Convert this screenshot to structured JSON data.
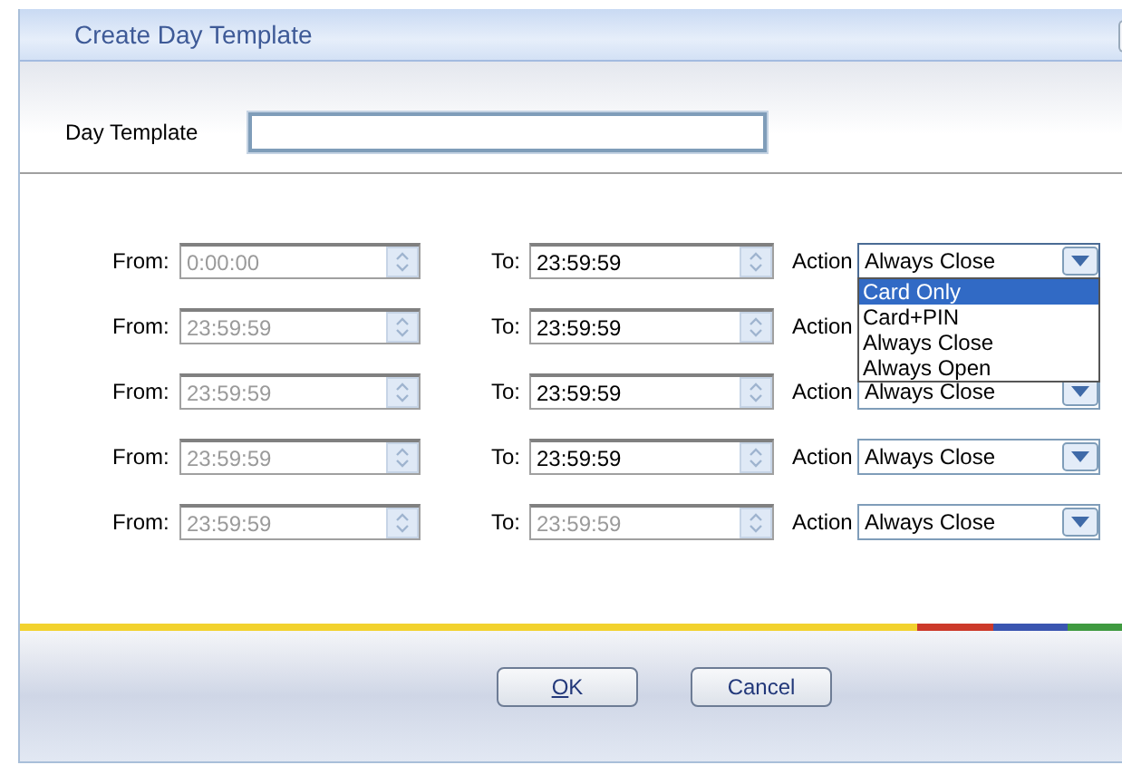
{
  "window": {
    "title": "Create Day Template"
  },
  "day_template": {
    "label": "Day Template"
  },
  "rows": [
    {
      "from_label": "From:",
      "from": "0:00:00",
      "from_disabled": true,
      "to_label": "To:",
      "to": "23:59:59",
      "to_disabled": false,
      "action_label": "Action",
      "action": "Always Close",
      "expanded": true,
      "options": [
        {
          "label": "Card Only",
          "selected": true
        },
        {
          "label": "Card+PIN",
          "selected": false
        },
        {
          "label": "Always Close",
          "selected": false
        },
        {
          "label": "Always Open",
          "selected": false
        }
      ]
    },
    {
      "from_label": "From:",
      "from": "23:59:59",
      "from_disabled": true,
      "to_label": "To:",
      "to": "23:59:59",
      "to_disabled": false,
      "action_label": "Action",
      "expanded": false
    },
    {
      "from_label": "From:",
      "from": "23:59:59",
      "from_disabled": true,
      "to_label": "To:",
      "to": "23:59:59",
      "to_disabled": false,
      "action_label": "Action",
      "action": "Always Close",
      "expanded": false
    },
    {
      "from_label": "From:",
      "from": "23:59:59",
      "from_disabled": true,
      "to_label": "To:",
      "to": "23:59:59",
      "to_disabled": false,
      "action_label": "Action",
      "action": "Always Close",
      "expanded": false
    },
    {
      "from_label": "From:",
      "from": "23:59:59",
      "from_disabled": true,
      "to_label": "To:",
      "to": "23:59:59",
      "to_disabled": true,
      "action_label": "Action",
      "action": "Always Close",
      "expanded": false
    }
  ],
  "buttons": [
    {
      "label": "OK",
      "underline_first": true
    },
    {
      "label": "Cancel",
      "underline_first": false
    }
  ]
}
